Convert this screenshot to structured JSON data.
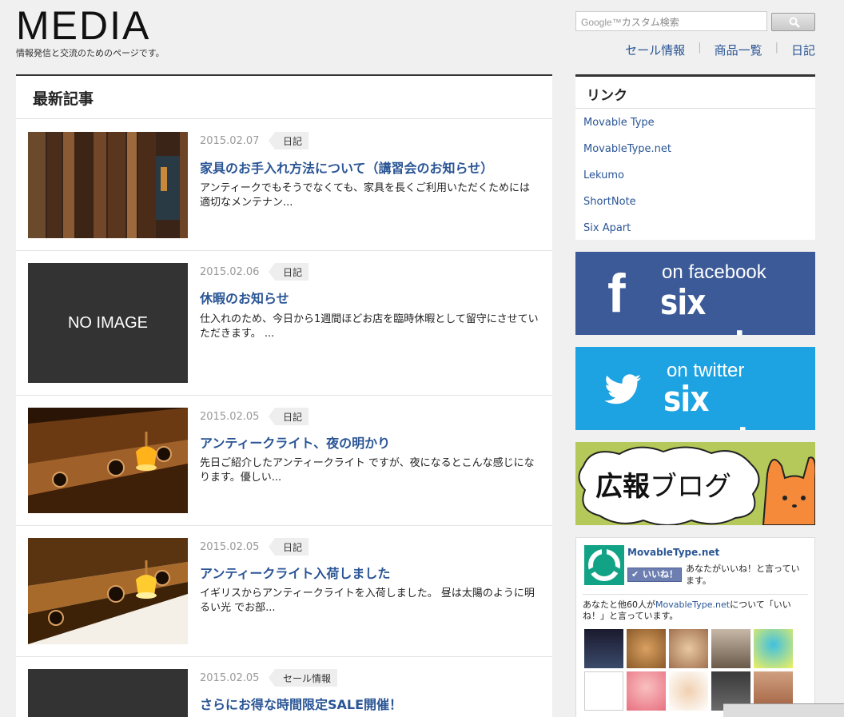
{
  "header": {
    "logo": "MEDIA",
    "tagline": "情報発信と交流のためのページです。",
    "search_brand": "Google™",
    "search_placeholder": "カスタム検索",
    "nav": [
      "セール情報",
      "商品一覧",
      "日記"
    ]
  },
  "main": {
    "title": "最新記事",
    "articles": [
      {
        "date": "2015.02.07",
        "tag": "日記",
        "title": "家具のお手入れ方法について（講習会のお知らせ）",
        "excerpt": "アンティークでもそうでなくても、家具を長くご利用いただくためには適切なメンテナン...",
        "thumb": "wood-image"
      },
      {
        "date": "2015.02.06",
        "tag": "日記",
        "title": "休暇のお知らせ",
        "excerpt": "仕入れのため、今日から1週間ほどお店を臨時休暇として留守にさせていただきます。 ...",
        "thumb": "no-image",
        "thumb_text": "NO IMAGE"
      },
      {
        "date": "2015.02.05",
        "tag": "日記",
        "title": "アンティークライト、夜の明かり",
        "excerpt": "先日ご紹介したアンティークライト ですが、夜になるとこんな感じになります。優しい...",
        "thumb": "lamp-night-image"
      },
      {
        "date": "2015.02.05",
        "tag": "日記",
        "title": "アンティークライト入荷しました",
        "excerpt": "イギリスからアンティークライトを入荷しました。 昼は太陽のように明るい光 でお部...",
        "thumb": "lamp-day-image"
      },
      {
        "date": "2015.02.05",
        "tag": "セール情報",
        "title": "さらにお得な時間限定SALE開催！",
        "excerpt": "",
        "thumb": "no-image"
      }
    ]
  },
  "sidebar": {
    "links_title": "リンク",
    "links": [
      "Movable Type",
      "MovableType.net",
      "Lekumo",
      "ShortNote",
      "Six Apart"
    ],
    "facebook_banner": {
      "small": "on facebook",
      "big": "six apart",
      "color": "#3b5a97"
    },
    "twitter_banner": {
      "small": "on twitter",
      "big": "six apart",
      "color": "#1da2e2"
    },
    "kouho_banner": {
      "bold": "広報",
      "light": "ブログ"
    },
    "fb_box": {
      "page_name": "MovableType.net",
      "like_label": "いいね！",
      "like_desc": "あなたがいいね！と言っています。",
      "friends_prefix": "あなたと他60人が",
      "friends_link": "MovableType.net",
      "friends_suffix": "について「いいね！」と言っています。"
    }
  }
}
